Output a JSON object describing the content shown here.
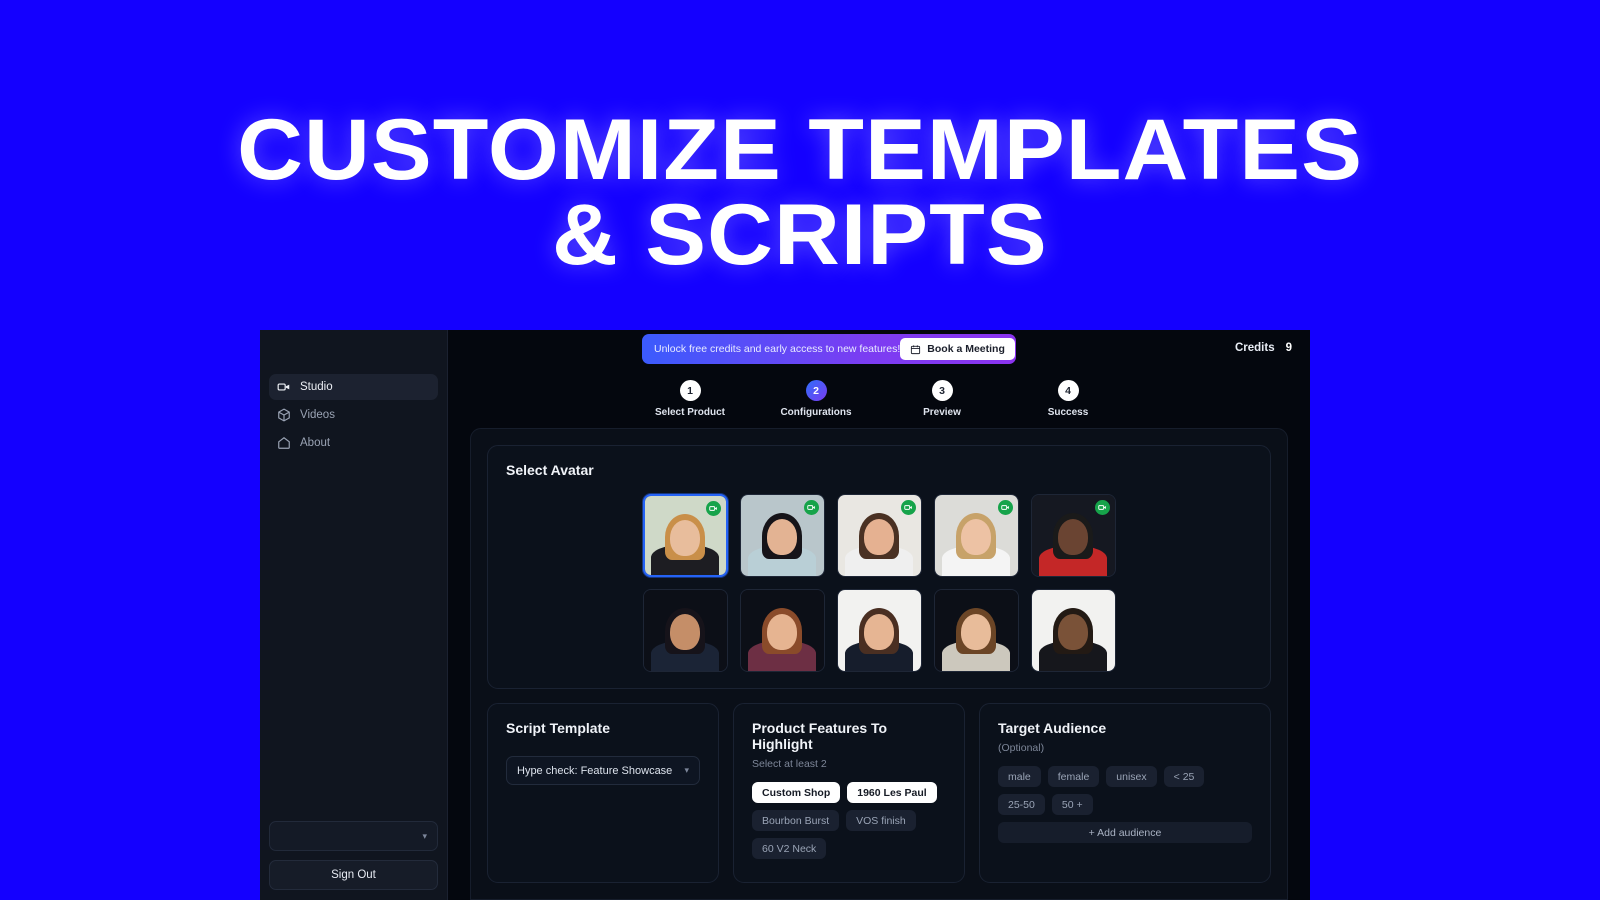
{
  "hero": {
    "line1": "CUSTOMIZE TEMPLATES",
    "line2": "& SCRIPTS",
    "bg_color": "#1400ff",
    "text_color": "#ffffff"
  },
  "sidebar": {
    "items": [
      {
        "label": "Studio",
        "icon": "video-camera-icon",
        "active": true
      },
      {
        "label": "Videos",
        "icon": "cube-icon",
        "active": false
      },
      {
        "label": "About",
        "icon": "home-icon",
        "active": false
      }
    ],
    "account_select_value": "",
    "sign_out_label": "Sign Out"
  },
  "topbar": {
    "promo_text": "Unlock free credits and early access to new features!",
    "book_button_label": "Book a Meeting",
    "book_button_icon": "calendar-icon",
    "credits_label": "Credits",
    "credits_value": "9",
    "promo_gradient_from": "#3b5bfd",
    "promo_gradient_to": "#8b33ef"
  },
  "stepper": {
    "steps": [
      {
        "number": "1",
        "label": "Select Product",
        "current": false
      },
      {
        "number": "2",
        "label": "Configurations",
        "current": true
      },
      {
        "number": "3",
        "label": "Preview",
        "current": false
      },
      {
        "number": "4",
        "label": "Success",
        "current": false
      }
    ],
    "current_accent": "#7a3cf0"
  },
  "avatar_panel": {
    "title": "Select Avatar",
    "selected_index": 0,
    "badge_icon": "video-badge-icon",
    "badge_color": "#16a34a",
    "selection_color": "#2563f6",
    "avatars": [
      {
        "name": "avatar-1",
        "bg": "#cfd9c8",
        "skin": "#e8bd9c",
        "hair": "#c98f49",
        "top": "#1d1d22",
        "badge": true
      },
      {
        "name": "avatar-2",
        "bg": "#b9c6cb",
        "skin": "#e3b393",
        "hair": "#161419",
        "top": "#b9cfd6",
        "badge": true
      },
      {
        "name": "avatar-3",
        "bg": "#e9e7e2",
        "skin": "#e5b191",
        "hair": "#4a3123",
        "top": "#efefef",
        "badge": true
      },
      {
        "name": "avatar-4",
        "bg": "#dcdcd8",
        "skin": "#edc2a4",
        "hair": "#c7a269",
        "top": "#f4f4f4",
        "badge": true
      },
      {
        "name": "avatar-5",
        "bg": "#151821",
        "skin": "#6a4432",
        "hair": "#1a1a1a",
        "top": "#c42727",
        "badge": true
      },
      {
        "name": "avatar-6",
        "bg": "#0c0f17",
        "skin": "#c58e68",
        "hair": "#16131a",
        "top": "#1b2436",
        "badge": false
      },
      {
        "name": "avatar-7",
        "bg": "#0c0f17",
        "skin": "#e6b491",
        "hair": "#8a4b2a",
        "top": "#6d2f44",
        "badge": false
      },
      {
        "name": "avatar-8",
        "bg": "#f2f2f0",
        "skin": "#e6b593",
        "hair": "#4a2f22",
        "top": "#161d2c",
        "badge": false
      },
      {
        "name": "avatar-9",
        "bg": "#0c0f17",
        "skin": "#e8bc9a",
        "hair": "#6b4526",
        "top": "#ccc8bd",
        "badge": false
      },
      {
        "name": "avatar-10",
        "bg": "#f2f2f0",
        "skin": "#7a5238",
        "hair": "#231a14",
        "top": "#16171c",
        "badge": false
      }
    ]
  },
  "script_template": {
    "title": "Script Template",
    "selected_value": "Hype check: Feature Showcase",
    "chevron": "chevron-down-icon"
  },
  "product_features": {
    "title": "Product Features To Highlight",
    "subtitle": "Select at least 2",
    "chips": [
      {
        "label": "Custom Shop",
        "selected": true
      },
      {
        "label": "1960 Les Paul",
        "selected": true
      },
      {
        "label": "Bourbon Burst",
        "selected": false
      },
      {
        "label": "VOS finish",
        "selected": false
      },
      {
        "label": "60 V2 Neck",
        "selected": false
      }
    ]
  },
  "target_audience": {
    "title": "Target Audience",
    "subtitle": "(Optional)",
    "chips": [
      {
        "label": "male",
        "selected": false
      },
      {
        "label": "female",
        "selected": false
      },
      {
        "label": "unisex",
        "selected": false
      },
      {
        "label": "< 25",
        "selected": false
      },
      {
        "label": "25-50",
        "selected": false
      },
      {
        "label": "50 +",
        "selected": false
      }
    ],
    "add_button_label": "+ Add audience"
  }
}
